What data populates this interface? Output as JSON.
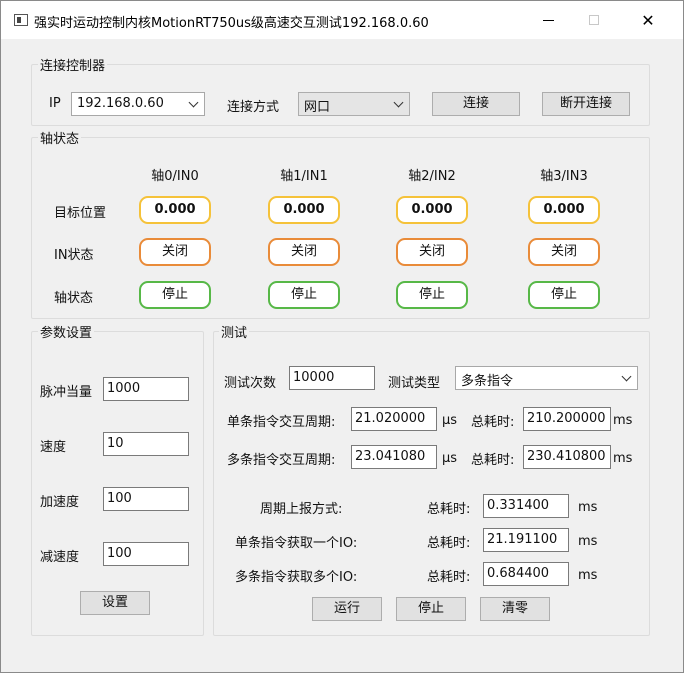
{
  "window": {
    "title": "强实时运动控制内核MotionRT750us级高速交互测试192.168.0.60",
    "close_glyph": "✕"
  },
  "connect": {
    "group_title": "连接控制器",
    "ip_label": "IP",
    "ip_value": "192.168.0.60",
    "mode_label": "连接方式",
    "mode_value": "网口",
    "connect_label": "连接",
    "disconnect_label": "断开连接"
  },
  "axis_status": {
    "group_title": "轴状态",
    "headers": [
      "轴0/IN0",
      "轴1/IN1",
      "轴2/IN2",
      "轴3/IN3"
    ],
    "row_labels": {
      "target": "目标位置",
      "in_state": "IN状态",
      "axis_state": "轴状态"
    },
    "target": [
      "0.000",
      "0.000",
      "0.000",
      "0.000"
    ],
    "in_state": [
      "关闭",
      "关闭",
      "关闭",
      "关闭"
    ],
    "axis_state": [
      "停止",
      "停止",
      "停止",
      "停止"
    ]
  },
  "params": {
    "group_title": "参数设置",
    "pulse_label": "脉冲当量",
    "pulse_value": "1000",
    "speed_label": "速度",
    "speed_value": "10",
    "accel_label": "加速度",
    "accel_value": "100",
    "decel_label": "减速度",
    "decel_value": "100",
    "set_label": "设置"
  },
  "test": {
    "group_title": "测试",
    "count_label": "测试次数",
    "count_value": "10000",
    "type_label": "测试类型",
    "type_value": "多条指令",
    "single_period_label": "单条指令交互周期:",
    "single_period_value": "21.020000",
    "multi_period_label": "多条指令交互周期:",
    "multi_period_value": "23.041080",
    "unit_us": "μs",
    "total_label": "总耗时:",
    "single_total_value": "210.200000",
    "multi_total_value": "230.410800",
    "unit_ms": "ms",
    "report_label": "周期上报方式:",
    "report_value": "0.331400",
    "single_io_label": "单条指令获取一个IO:",
    "single_io_value": "21.191100",
    "multi_io_label": "多条指令获取多个IO:",
    "multi_io_value": "0.684400",
    "run_label": "运行",
    "stop_label": "停止",
    "clear_label": "清零"
  }
}
